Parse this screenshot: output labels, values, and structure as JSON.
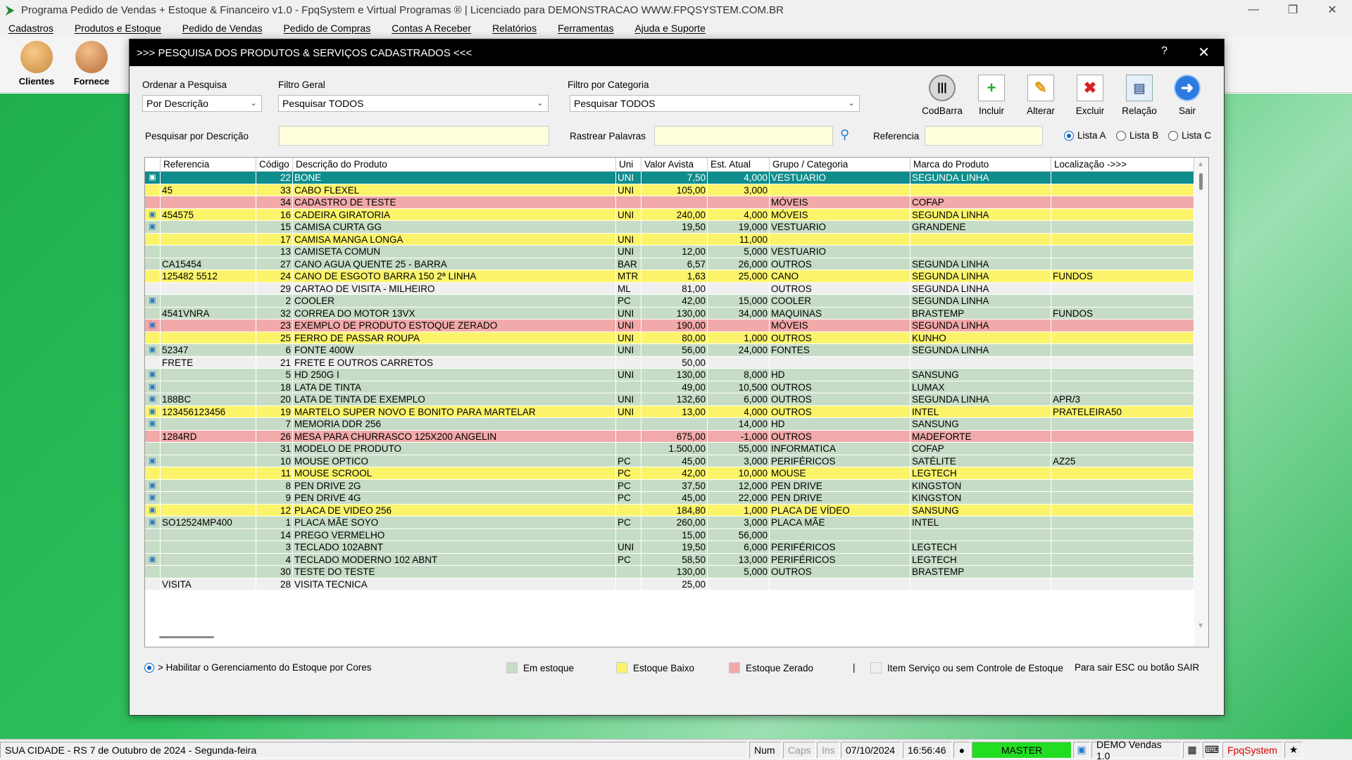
{
  "window": {
    "title": "Programa Pedido de Vendas + Estoque & Financeiro v1.0 - FpqSystem e Virtual Programas ® | Licenciado para  DEMONSTRACAO WWW.FPQSYSTEM.COM.BR"
  },
  "menu": [
    "Cadastros",
    "Produtos e Estoque",
    "Pedido de Vendas",
    "Pedido de Compras",
    "Contas A Receber",
    "Relatórios",
    "Ferramentas",
    "Ajuda e Suporte"
  ],
  "toolbar": {
    "clientes": "Clientes",
    "fornece": "Fornece"
  },
  "modal": {
    "title": ">>>  PESQUISA DOS PRODUTOS & SERVIÇOS CADASTRADOS  <<<",
    "help": "?",
    "ordenar_label": "Ordenar a Pesquisa",
    "ordenar_value": "Por Descrição",
    "filtro_geral_label": "Filtro Geral",
    "filtro_geral_value": "Pesquisar TODOS",
    "filtro_cat_label": "Filtro por Categoria",
    "filtro_cat_value": "Pesquisar TODOS",
    "pesq_desc_label": "Pesquisar por Descrição",
    "rastrear_label": "Rastrear Palavras",
    "referencia_label": "Referencia",
    "buttons": {
      "codbarra": "CodBarra",
      "incluir": "Incluir",
      "alterar": "Alterar",
      "excluir": "Excluir",
      "relacao": "Relação",
      "sair": "Sair"
    },
    "lists": {
      "a": "Lista A",
      "b": "Lista B",
      "c": "Lista C"
    }
  },
  "grid": {
    "headers": [
      "Referencia",
      "Código",
      "Descrição do Produto",
      "Uni",
      "Valor Avista",
      "Est. Atual",
      "Grupo / Categoria",
      "Marca do Produto",
      "Localização ->>>"
    ],
    "rows": [
      {
        "ic": true,
        "ref": "",
        "cod": "22",
        "desc": "BONE",
        "uni": "UNI",
        "val": "7,50",
        "est": "4,000",
        "grp": "VESTUARIO",
        "mar": "SEGUNDA LINHA",
        "loc": "",
        "color": "sel"
      },
      {
        "ic": false,
        "ref": "45",
        "cod": "33",
        "desc": "CABO FLEXEL",
        "uni": "UNI",
        "val": "105,00",
        "est": "3,000",
        "grp": "",
        "mar": "",
        "loc": "",
        "color": "yellow"
      },
      {
        "ic": false,
        "ref": "",
        "cod": "34",
        "desc": "CADASTRO DE TESTE",
        "uni": "",
        "val": "",
        "est": "",
        "grp": "MÓVEIS",
        "mar": "COFAP",
        "loc": "",
        "color": "red"
      },
      {
        "ic": true,
        "ref": "454575",
        "cod": "16",
        "desc": "CADEIRA GIRATORIA",
        "uni": "UNI",
        "val": "240,00",
        "est": "4,000",
        "grp": "MÓVEIS",
        "mar": "SEGUNDA LINHA",
        "loc": "",
        "color": "yellow"
      },
      {
        "ic": true,
        "ref": "",
        "cod": "15",
        "desc": "CAMISA CURTA GG",
        "uni": "",
        "val": "19,50",
        "est": "19,000",
        "grp": "VESTUARIO",
        "mar": "GRANDENE",
        "loc": "",
        "color": "green"
      },
      {
        "ic": false,
        "ref": "",
        "cod": "17",
        "desc": "CAMISA MANGA LONGA",
        "uni": "UNI",
        "val": "",
        "est": "11,000",
        "grp": "",
        "mar": "",
        "loc": "",
        "color": "yellow"
      },
      {
        "ic": false,
        "ref": "",
        "cod": "13",
        "desc": "CAMISETA COMUN",
        "uni": "UNI",
        "val": "12,00",
        "est": "5,000",
        "grp": "VESTUARIO",
        "mar": "",
        "loc": "",
        "color": "green"
      },
      {
        "ic": false,
        "ref": "CA15454",
        "cod": "27",
        "desc": "CANO AGUA QUENTE 25 - BARRA",
        "uni": "BAR",
        "val": "6,57",
        "est": "26,000",
        "grp": "OUTROS",
        "mar": "SEGUNDA LINHA",
        "loc": "",
        "color": "green"
      },
      {
        "ic": false,
        "ref": "125482 5512",
        "cod": "24",
        "desc": "CANO DE ESGOTO BARRA 150 2ª LINHA",
        "uni": "MTR",
        "val": "1,63",
        "est": "25,000",
        "grp": "CANO",
        "mar": "SEGUNDA LINHA",
        "loc": "FUNDOS",
        "color": "yellow"
      },
      {
        "ic": false,
        "ref": "",
        "cod": "29",
        "desc": "CARTAO DE VISITA - MILHEIRO",
        "uni": "ML",
        "val": "81,00",
        "est": "",
        "grp": "OUTROS",
        "mar": "SEGUNDA LINHA",
        "loc": "",
        "color": "white"
      },
      {
        "ic": true,
        "ref": "",
        "cod": "2",
        "desc": "COOLER",
        "uni": "PC",
        "val": "42,00",
        "est": "15,000",
        "grp": "COOLER",
        "mar": "SEGUNDA LINHA",
        "loc": "",
        "color": "green"
      },
      {
        "ic": false,
        "ref": "4541VNRA",
        "cod": "32",
        "desc": "CORREA DO MOTOR 13VX",
        "uni": "UNI",
        "val": "130,00",
        "est": "34,000",
        "grp": "MAQUINAS",
        "mar": "BRASTEMP",
        "loc": "FUNDOS",
        "color": "green"
      },
      {
        "ic": true,
        "ref": "",
        "cod": "23",
        "desc": "EXEMPLO DE PRODUTO ESTOQUE ZERADO",
        "uni": "UNI",
        "val": "190,00",
        "est": "",
        "grp": "MÓVEIS",
        "mar": "SEGUNDA LINHA",
        "loc": "",
        "color": "red"
      },
      {
        "ic": false,
        "ref": "",
        "cod": "25",
        "desc": "FERRO DE PASSAR ROUPA",
        "uni": "UNI",
        "val": "80,00",
        "est": "1,000",
        "grp": "OUTROS",
        "mar": "KUNHO",
        "loc": "",
        "color": "yellow"
      },
      {
        "ic": true,
        "ref": "52347",
        "cod": "6",
        "desc": "FONTE 400W",
        "uni": "UNI",
        "val": "56,00",
        "est": "24,000",
        "grp": "FONTES",
        "mar": "SEGUNDA LINHA",
        "loc": "",
        "color": "green"
      },
      {
        "ic": false,
        "ref": "FRETE",
        "cod": "21",
        "desc": "FRETE E OUTROS CARRETOS",
        "uni": "",
        "val": "50,00",
        "est": "",
        "grp": "",
        "mar": "",
        "loc": "",
        "color": "white"
      },
      {
        "ic": true,
        "ref": "",
        "cod": "5",
        "desc": "HD 250G   I",
        "uni": "UNI",
        "val": "130,00",
        "est": "8,000",
        "grp": "HD",
        "mar": "SANSUNG",
        "loc": "",
        "color": "green"
      },
      {
        "ic": true,
        "ref": "",
        "cod": "18",
        "desc": "LATA DE TINTA",
        "uni": "",
        "val": "49,00",
        "est": "10,500",
        "grp": "OUTROS",
        "mar": "LUMAX",
        "loc": "",
        "color": "green"
      },
      {
        "ic": true,
        "ref": "188BC",
        "cod": "20",
        "desc": "LATA DE TINTA DE EXEMPLO",
        "uni": "UNI",
        "val": "132,60",
        "est": "6,000",
        "grp": "OUTROS",
        "mar": "SEGUNDA LINHA",
        "loc": "APR/3",
        "color": "green"
      },
      {
        "ic": true,
        "ref": "123456123456",
        "cod": "19",
        "desc": "MARTELO SUPER NOVO E BONITO PARA MARTELAR",
        "uni": "UNI",
        "val": "13,00",
        "est": "4,000",
        "grp": "OUTROS",
        "mar": "INTEL",
        "loc": "PRATELEIRA50",
        "color": "yellow"
      },
      {
        "ic": true,
        "ref": "",
        "cod": "7",
        "desc": "MEMORIA DDR 256",
        "uni": "",
        "val": "",
        "est": "14,000",
        "grp": "HD",
        "mar": "SANSUNG",
        "loc": "",
        "color": "green"
      },
      {
        "ic": false,
        "ref": "1284RD",
        "cod": "26",
        "desc": "MESA PARA CHURRASCO 125X200 ANGELIN",
        "uni": "",
        "val": "675,00",
        "est": "-1,000",
        "grp": "OUTROS",
        "mar": "MADEFORTE",
        "loc": "",
        "color": "red"
      },
      {
        "ic": false,
        "ref": "",
        "cod": "31",
        "desc": "MODELO DE PRODUTO",
        "uni": "",
        "val": "1.500,00",
        "est": "55,000",
        "grp": "INFORMATICA",
        "mar": "COFAP",
        "loc": "",
        "color": "green"
      },
      {
        "ic": true,
        "ref": "",
        "cod": "10",
        "desc": "MOUSE OPTICO",
        "uni": "PC",
        "val": "45,00",
        "est": "3,000",
        "grp": "PERIFÉRICOS",
        "mar": "SATÉLITE",
        "loc": "AZ25",
        "color": "green"
      },
      {
        "ic": false,
        "ref": "",
        "cod": "11",
        "desc": "MOUSE SCROOL",
        "uni": "PC",
        "val": "42,00",
        "est": "10,000",
        "grp": "MOUSE",
        "mar": "LEGTECH",
        "loc": "",
        "color": "yellow"
      },
      {
        "ic": true,
        "ref": "",
        "cod": "8",
        "desc": "PEN DRIVE 2G",
        "uni": "PC",
        "val": "37,50",
        "est": "12,000",
        "grp": "PEN DRIVE",
        "mar": "KINGSTON",
        "loc": "",
        "color": "green"
      },
      {
        "ic": true,
        "ref": "",
        "cod": "9",
        "desc": "PEN DRIVE 4G",
        "uni": "PC",
        "val": "45,00",
        "est": "22,000",
        "grp": "PEN DRIVE",
        "mar": "KINGSTON",
        "loc": "",
        "color": "green"
      },
      {
        "ic": true,
        "ref": "",
        "cod": "12",
        "desc": "PLACA DE VIDEO 256",
        "uni": "",
        "val": "184,80",
        "est": "1,000",
        "grp": "PLACA DE VÍDEO",
        "mar": "SANSUNG",
        "loc": "",
        "color": "yellow"
      },
      {
        "ic": true,
        "ref": "SO12524MP400",
        "cod": "1",
        "desc": "PLACA MÃE SOYO",
        "uni": "PC",
        "val": "260,00",
        "est": "3,000",
        "grp": "PLACA MÃE",
        "mar": "INTEL",
        "loc": "",
        "color": "green"
      },
      {
        "ic": false,
        "ref": "",
        "cod": "14",
        "desc": "PREGO VERMELHO",
        "uni": "",
        "val": "15,00",
        "est": "56,000",
        "grp": "",
        "mar": "",
        "loc": "",
        "color": "green"
      },
      {
        "ic": false,
        "ref": "",
        "cod": "3",
        "desc": "TECLADO 102ABNT",
        "uni": "UNI",
        "val": "19,50",
        "est": "6,000",
        "grp": "PERIFÉRICOS",
        "mar": "LEGTECH",
        "loc": "",
        "color": "green"
      },
      {
        "ic": true,
        "ref": "",
        "cod": "4",
        "desc": "TECLADO MODERNO 102 ABNT",
        "uni": "PC",
        "val": "58,50",
        "est": "13,000",
        "grp": "PERIFÉRICOS",
        "mar": "LEGTECH",
        "loc": "",
        "color": "green"
      },
      {
        "ic": false,
        "ref": "",
        "cod": "30",
        "desc": "TESTE DO TESTE",
        "uni": "",
        "val": "130,00",
        "est": "5,000",
        "grp": "OUTROS",
        "mar": "BRASTEMP",
        "loc": "",
        "color": "green"
      },
      {
        "ic": false,
        "ref": "VISITA",
        "cod": "28",
        "desc": "VISITA TECNICA",
        "uni": "",
        "val": "25,00",
        "est": "",
        "grp": "",
        "mar": "",
        "loc": "",
        "color": "white"
      }
    ]
  },
  "legend": {
    "habilitar": "> Habilitar o Gerenciamento do Estoque por Cores",
    "em_estoque": "Em estoque",
    "estoque_baixo": "Estoque Baixo",
    "estoque_zerado": "Estoque Zerado",
    "sep": "|",
    "servico": "Item Serviço ou sem Controle de Estoque",
    "sair_hint": "Para sair ESC ou botão SAIR",
    "colors": {
      "green": "#c6dcc6",
      "yellow": "#fbf46a",
      "red": "#f2a9a9",
      "white": "#efefef",
      "selected": "#0f8c8c"
    }
  },
  "status": {
    "city": "SUA CIDADE - RS  7 de Outubro de 2024 - Segunda-feira",
    "num": "Num",
    "caps": "Caps",
    "ins": "Ins",
    "date": "07/10/2024",
    "time": "16:56:46",
    "master": "MASTER",
    "demo": "DEMO Vendas 1.0",
    "brand": "FpqSystem"
  }
}
